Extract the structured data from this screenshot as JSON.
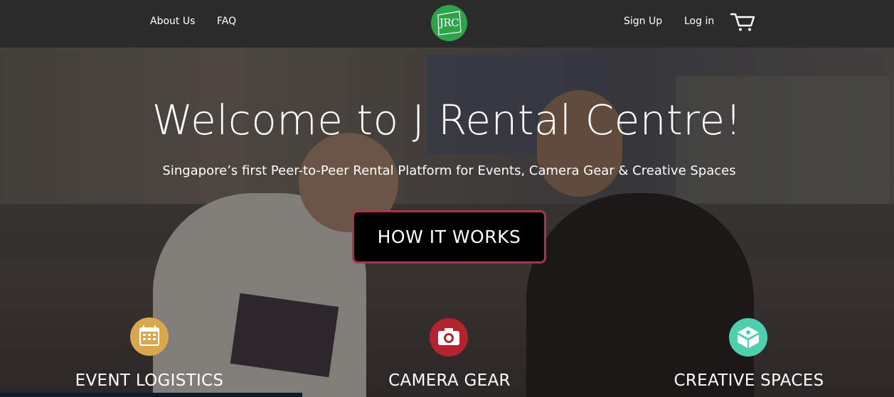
{
  "nav": {
    "about": "About Us",
    "faq": "FAQ",
    "logo_text": "JRC",
    "signup": "Sign Up",
    "login": "Log in"
  },
  "hero": {
    "title": "Welcome to J Rental Centre!",
    "subtitle": "Singapore’s first Peer-to-Peer Rental Platform for Events, Camera Gear & Creative Spaces",
    "cta": "HOW IT WORKS"
  },
  "categories": [
    {
      "label": "EVENT LOGISTICS",
      "icon": "calendar-icon",
      "color": "#d9a84e"
    },
    {
      "label": "CAMERA GEAR",
      "icon": "camera-icon",
      "color": "#b3242f"
    },
    {
      "label": "CREATIVE SPACES",
      "icon": "space-icon",
      "color": "#4fcfae"
    }
  ],
  "colors": {
    "navbar": "#2b2b2b",
    "logo": "#2da44a",
    "cta_border": "#a8354d"
  }
}
